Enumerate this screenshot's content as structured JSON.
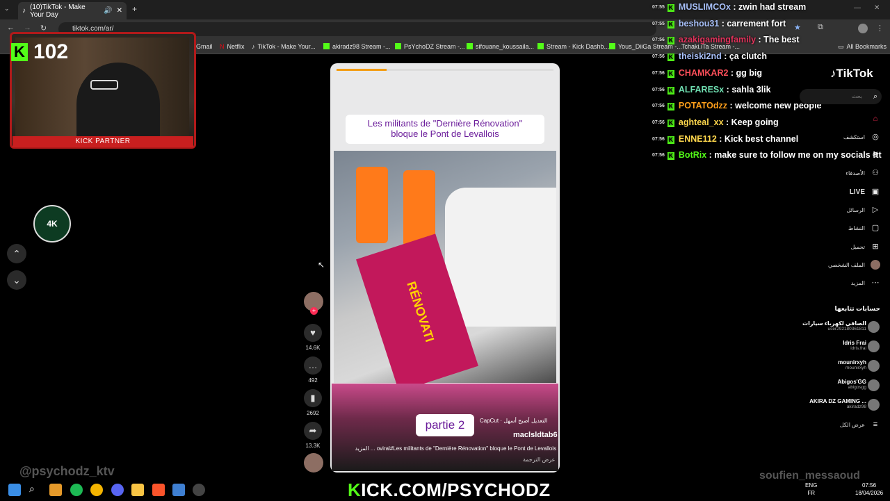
{
  "browser": {
    "tab_title": "(10)TikTok - Make Your Day",
    "url": "tiktok.com/ar/",
    "bookmarks": [
      "Gmail",
      "Netflix",
      "TikTok - Make Your...",
      "akiradz98 Stream -...",
      "PsYchoDZ Stream -...",
      "sifouane_koussaila...",
      "Stream - Kick Dashb...",
      "Yous_DiiGa Stream -...",
      "Tchaki.iTa Stream -..."
    ],
    "all_bookmarks": "All Bookmarks"
  },
  "stream": {
    "viewer_count": "102",
    "cam_badge": "KICK PARTNER",
    "logo_text": "4K",
    "watermark_left": "@psychodz_ktv",
    "watermark_right": "soufien_messaoud",
    "footer": "ICK.COM/PSYCHODZ"
  },
  "chat": [
    {
      "time": "07:55",
      "user": "MUSLIMCOx",
      "color": "#a7bff8",
      "msg": "zwin had stream"
    },
    {
      "time": "07:55",
      "user": "beshou31",
      "color": "#a7bff8",
      "msg": "carrement fort"
    },
    {
      "time": "07:56",
      "user": "azakigamingfamily",
      "color": "#e0315a",
      "msg": "The best"
    },
    {
      "time": "07:56",
      "user": "theiski2nd",
      "color": "#a7bff8",
      "msg": "ça clutch"
    },
    {
      "time": "07:56",
      "user": "CHAMKAR2",
      "color": "#ff4f5a",
      "msg": "gg big"
    },
    {
      "time": "07:56",
      "user": "ALFARESx",
      "color": "#6fdfb1",
      "msg": "sahla 3lik"
    },
    {
      "time": "07:56",
      "user": "POTATOdzz",
      "color": "#ff9f1a",
      "msg": "welcome new people"
    },
    {
      "time": "07:56",
      "user": "aghteal_xx",
      "color": "#ffd84d",
      "msg": "Keep going"
    },
    {
      "time": "07:56",
      "user": "ENNE112",
      "color": "#ffd84d",
      "msg": "Kick best channel"
    },
    {
      "time": "07:56",
      "user": "BotRix",
      "color": "#53fc18",
      "msg": "make sure to follow me on my socials !tt"
    }
  ],
  "video": {
    "title_line1": "Les militants de \"Dernière Rénovation\"",
    "title_line2": "bloque le Pont de Levallois",
    "partie": "partie 2",
    "capcut": "CapCut · التعديل أصبح أسهل",
    "author": "maclsldtab6",
    "caption": "oviral#Les militants de \"Dernière Rénovation\" bloque le Pont de Levallois ... المزيد",
    "translate": "عرض الترجمة",
    "banner_text": "RÉNOVATI",
    "likes": "14.6K",
    "comments": "492",
    "saves": "2692",
    "shares": "13.3K"
  },
  "tiktok": {
    "logo": "TikTok",
    "search_placeholder": "بحث",
    "nav": [
      {
        "label": "",
        "icon": "home-icon"
      },
      {
        "label": "استكشف",
        "icon": "compass-icon"
      },
      {
        "label": "",
        "icon": "following-icon"
      },
      {
        "label": "الأصدقاء",
        "icon": "friends-icon"
      },
      {
        "label": "LIVE",
        "icon": "live-icon"
      },
      {
        "label": "الرسائل",
        "icon": "messages-icon"
      },
      {
        "label": "النشاط",
        "icon": "activity-icon"
      },
      {
        "label": "تحميل",
        "icon": "upload-icon"
      },
      {
        "label": "الملف الشخصي",
        "icon": "profile-icon"
      },
      {
        "label": "المزيد",
        "icon": "more-icon"
      }
    ],
    "following_header": "حسابات تتابعها",
    "following": [
      {
        "name": "الصافي لكهرباء سيارات",
        "user": "user292180361811"
      },
      {
        "name": "Idris Frai",
        "user": "idris.frai"
      },
      {
        "name": "mounirxyh",
        "user": "mounirxyh"
      },
      {
        "name": "Abigos'GG",
        "user": "abigosgg"
      },
      {
        "name": "AKIRA DZ GAMING ...",
        "user": "akiradz98"
      }
    ],
    "see_all": "عرض الكل"
  },
  "system": {
    "lang1": "ENG",
    "lang2": "FR",
    "time": "07:56",
    "date": "18/04/2026"
  },
  "colors": {
    "kick_green": "#53fc18",
    "tiktok_red": "#fe2c55"
  }
}
